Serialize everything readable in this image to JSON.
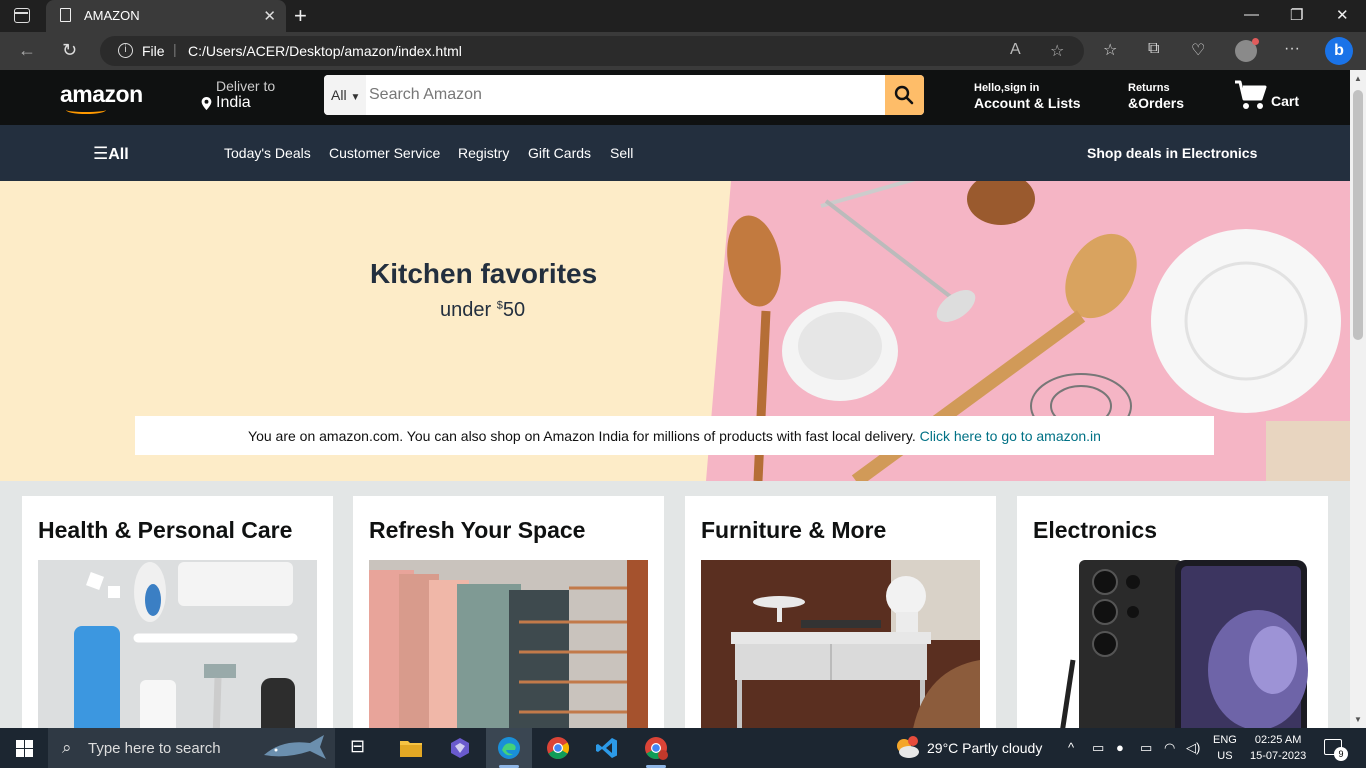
{
  "browser": {
    "tab_title": "AMAZON",
    "file_label": "File",
    "url": "C:/Users/ACER/Desktop/amazon/index.html"
  },
  "header": {
    "logo": "amazon",
    "deliver_line1": "Deliver to",
    "deliver_line2": "India",
    "search_category": "All",
    "search_placeholder": "Search Amazon",
    "account_line1": "Hello,sign in",
    "account_line2": "Account & Lists",
    "returns_line1": "Returns",
    "returns_line2": "&Orders",
    "cart_label": "Cart"
  },
  "subnav": {
    "all_label": "All",
    "links": [
      "Today's Deals",
      "Customer Service",
      "Registry",
      "Gift Cards",
      "Sell"
    ],
    "promo": "Shop deals in Electronics"
  },
  "hero": {
    "title": "Kitchen favorites",
    "subtitle_prefix": "under ",
    "subtitle_currency": "$",
    "subtitle_amount": "50",
    "notice_text": "You are on amazon.com. You can also shop on Amazon India for millions of products with fast local delivery. ",
    "notice_link": "Click here to go to amazon.in"
  },
  "cards": [
    {
      "title": "Health & Personal Care"
    },
    {
      "title": "Refresh Your Space"
    },
    {
      "title": "Furniture & More"
    },
    {
      "title": "Electronics"
    }
  ],
  "taskbar": {
    "search_placeholder": "Type here to search",
    "weather_text": "29°C  Partly cloudy",
    "lang_line1": "ENG",
    "lang_line2": "US",
    "time": "02:25 AM",
    "date": "15-07-2023",
    "notifications": "9"
  },
  "colors": {
    "header_bg": "#0f1111",
    "subnav_bg": "#232f3e",
    "search_button": "#febd69",
    "hero_left": "#fdecc8",
    "hero_right": "#f5b5c5",
    "link": "#007185"
  }
}
